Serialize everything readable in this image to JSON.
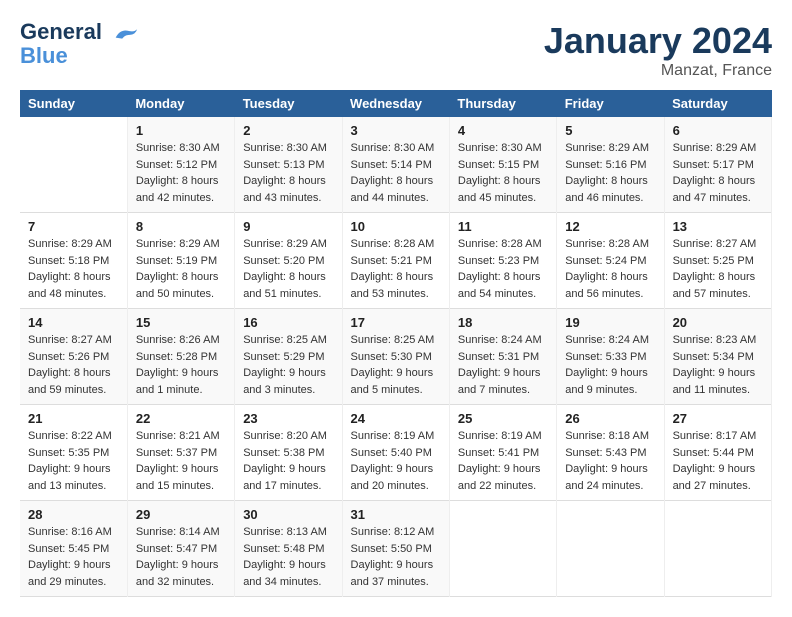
{
  "header": {
    "logo_line1": "General",
    "logo_line2": "Blue",
    "month_title": "January 2024",
    "location": "Manzat, France"
  },
  "days_of_week": [
    "Sunday",
    "Monday",
    "Tuesday",
    "Wednesday",
    "Thursday",
    "Friday",
    "Saturday"
  ],
  "weeks": [
    [
      {
        "day": "",
        "sunrise": "",
        "sunset": "",
        "daylight": ""
      },
      {
        "day": "1",
        "sunrise": "Sunrise: 8:30 AM",
        "sunset": "Sunset: 5:12 PM",
        "daylight": "Daylight: 8 hours and 42 minutes."
      },
      {
        "day": "2",
        "sunrise": "Sunrise: 8:30 AM",
        "sunset": "Sunset: 5:13 PM",
        "daylight": "Daylight: 8 hours and 43 minutes."
      },
      {
        "day": "3",
        "sunrise": "Sunrise: 8:30 AM",
        "sunset": "Sunset: 5:14 PM",
        "daylight": "Daylight: 8 hours and 44 minutes."
      },
      {
        "day": "4",
        "sunrise": "Sunrise: 8:30 AM",
        "sunset": "Sunset: 5:15 PM",
        "daylight": "Daylight: 8 hours and 45 minutes."
      },
      {
        "day": "5",
        "sunrise": "Sunrise: 8:29 AM",
        "sunset": "Sunset: 5:16 PM",
        "daylight": "Daylight: 8 hours and 46 minutes."
      },
      {
        "day": "6",
        "sunrise": "Sunrise: 8:29 AM",
        "sunset": "Sunset: 5:17 PM",
        "daylight": "Daylight: 8 hours and 47 minutes."
      }
    ],
    [
      {
        "day": "7",
        "sunrise": "Sunrise: 8:29 AM",
        "sunset": "Sunset: 5:18 PM",
        "daylight": "Daylight: 8 hours and 48 minutes."
      },
      {
        "day": "8",
        "sunrise": "Sunrise: 8:29 AM",
        "sunset": "Sunset: 5:19 PM",
        "daylight": "Daylight: 8 hours and 50 minutes."
      },
      {
        "day": "9",
        "sunrise": "Sunrise: 8:29 AM",
        "sunset": "Sunset: 5:20 PM",
        "daylight": "Daylight: 8 hours and 51 minutes."
      },
      {
        "day": "10",
        "sunrise": "Sunrise: 8:28 AM",
        "sunset": "Sunset: 5:21 PM",
        "daylight": "Daylight: 8 hours and 53 minutes."
      },
      {
        "day": "11",
        "sunrise": "Sunrise: 8:28 AM",
        "sunset": "Sunset: 5:23 PM",
        "daylight": "Daylight: 8 hours and 54 minutes."
      },
      {
        "day": "12",
        "sunrise": "Sunrise: 8:28 AM",
        "sunset": "Sunset: 5:24 PM",
        "daylight": "Daylight: 8 hours and 56 minutes."
      },
      {
        "day": "13",
        "sunrise": "Sunrise: 8:27 AM",
        "sunset": "Sunset: 5:25 PM",
        "daylight": "Daylight: 8 hours and 57 minutes."
      }
    ],
    [
      {
        "day": "14",
        "sunrise": "Sunrise: 8:27 AM",
        "sunset": "Sunset: 5:26 PM",
        "daylight": "Daylight: 8 hours and 59 minutes."
      },
      {
        "day": "15",
        "sunrise": "Sunrise: 8:26 AM",
        "sunset": "Sunset: 5:28 PM",
        "daylight": "Daylight: 9 hours and 1 minute."
      },
      {
        "day": "16",
        "sunrise": "Sunrise: 8:25 AM",
        "sunset": "Sunset: 5:29 PM",
        "daylight": "Daylight: 9 hours and 3 minutes."
      },
      {
        "day": "17",
        "sunrise": "Sunrise: 8:25 AM",
        "sunset": "Sunset: 5:30 PM",
        "daylight": "Daylight: 9 hours and 5 minutes."
      },
      {
        "day": "18",
        "sunrise": "Sunrise: 8:24 AM",
        "sunset": "Sunset: 5:31 PM",
        "daylight": "Daylight: 9 hours and 7 minutes."
      },
      {
        "day": "19",
        "sunrise": "Sunrise: 8:24 AM",
        "sunset": "Sunset: 5:33 PM",
        "daylight": "Daylight: 9 hours and 9 minutes."
      },
      {
        "day": "20",
        "sunrise": "Sunrise: 8:23 AM",
        "sunset": "Sunset: 5:34 PM",
        "daylight": "Daylight: 9 hours and 11 minutes."
      }
    ],
    [
      {
        "day": "21",
        "sunrise": "Sunrise: 8:22 AM",
        "sunset": "Sunset: 5:35 PM",
        "daylight": "Daylight: 9 hours and 13 minutes."
      },
      {
        "day": "22",
        "sunrise": "Sunrise: 8:21 AM",
        "sunset": "Sunset: 5:37 PM",
        "daylight": "Daylight: 9 hours and 15 minutes."
      },
      {
        "day": "23",
        "sunrise": "Sunrise: 8:20 AM",
        "sunset": "Sunset: 5:38 PM",
        "daylight": "Daylight: 9 hours and 17 minutes."
      },
      {
        "day": "24",
        "sunrise": "Sunrise: 8:19 AM",
        "sunset": "Sunset: 5:40 PM",
        "daylight": "Daylight: 9 hours and 20 minutes."
      },
      {
        "day": "25",
        "sunrise": "Sunrise: 8:19 AM",
        "sunset": "Sunset: 5:41 PM",
        "daylight": "Daylight: 9 hours and 22 minutes."
      },
      {
        "day": "26",
        "sunrise": "Sunrise: 8:18 AM",
        "sunset": "Sunset: 5:43 PM",
        "daylight": "Daylight: 9 hours and 24 minutes."
      },
      {
        "day": "27",
        "sunrise": "Sunrise: 8:17 AM",
        "sunset": "Sunset: 5:44 PM",
        "daylight": "Daylight: 9 hours and 27 minutes."
      }
    ],
    [
      {
        "day": "28",
        "sunrise": "Sunrise: 8:16 AM",
        "sunset": "Sunset: 5:45 PM",
        "daylight": "Daylight: 9 hours and 29 minutes."
      },
      {
        "day": "29",
        "sunrise": "Sunrise: 8:14 AM",
        "sunset": "Sunset: 5:47 PM",
        "daylight": "Daylight: 9 hours and 32 minutes."
      },
      {
        "day": "30",
        "sunrise": "Sunrise: 8:13 AM",
        "sunset": "Sunset: 5:48 PM",
        "daylight": "Daylight: 9 hours and 34 minutes."
      },
      {
        "day": "31",
        "sunrise": "Sunrise: 8:12 AM",
        "sunset": "Sunset: 5:50 PM",
        "daylight": "Daylight: 9 hours and 37 minutes."
      },
      {
        "day": "",
        "sunrise": "",
        "sunset": "",
        "daylight": ""
      },
      {
        "day": "",
        "sunrise": "",
        "sunset": "",
        "daylight": ""
      },
      {
        "day": "",
        "sunrise": "",
        "sunset": "",
        "daylight": ""
      }
    ]
  ]
}
